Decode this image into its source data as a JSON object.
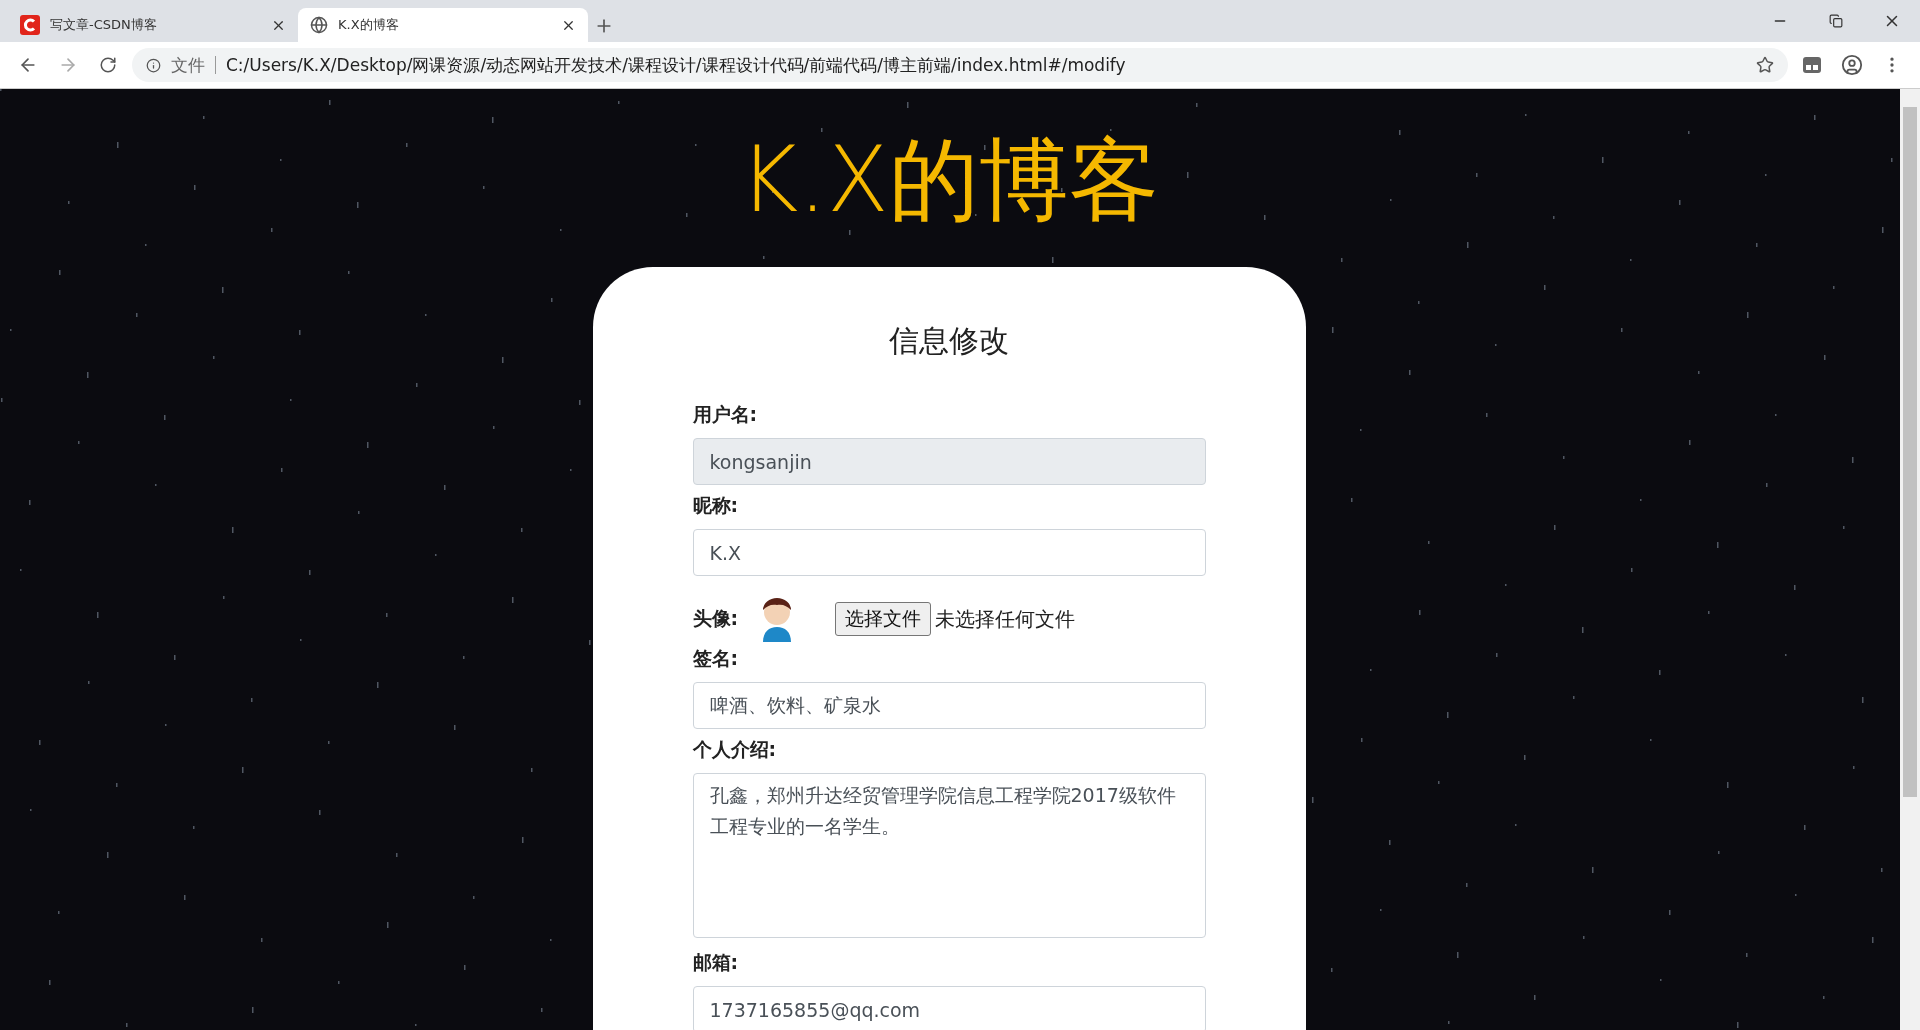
{
  "browser": {
    "tabs": [
      {
        "title": "写文章-CSDN博客",
        "selected": false
      },
      {
        "title": "K.X的博客",
        "selected": true
      }
    ],
    "address": {
      "security_label": "文件",
      "url": "C:/Users/K.X/Desktop/网课资源/动态网站开发技术/课程设计/课程设计代码/前端代码/博主前端/index.html#/modify"
    }
  },
  "page": {
    "title": "K.X的博客",
    "form": {
      "heading": "信息修改",
      "fields": [
        {
          "kind": "text",
          "label": "用户名:",
          "value": "kongsanjin",
          "disabled": true
        },
        {
          "kind": "text",
          "label": "昵称:",
          "value": "K.X",
          "disabled": false
        },
        {
          "kind": "avatar",
          "label": "头像:",
          "button": "选择文件",
          "status": "未选择任何文件"
        },
        {
          "kind": "text",
          "label": "签名:",
          "value": "啤酒、饮料、矿泉水",
          "disabled": false
        },
        {
          "kind": "textarea",
          "label": "个人介绍:",
          "value": "孔鑫，郑州升达经贸管理学院信息工程学院2017级软件工程专业的一名学生。"
        },
        {
          "kind": "text",
          "label": "邮箱:",
          "value": "1737165855@qq.com",
          "disabled": false
        }
      ]
    }
  }
}
